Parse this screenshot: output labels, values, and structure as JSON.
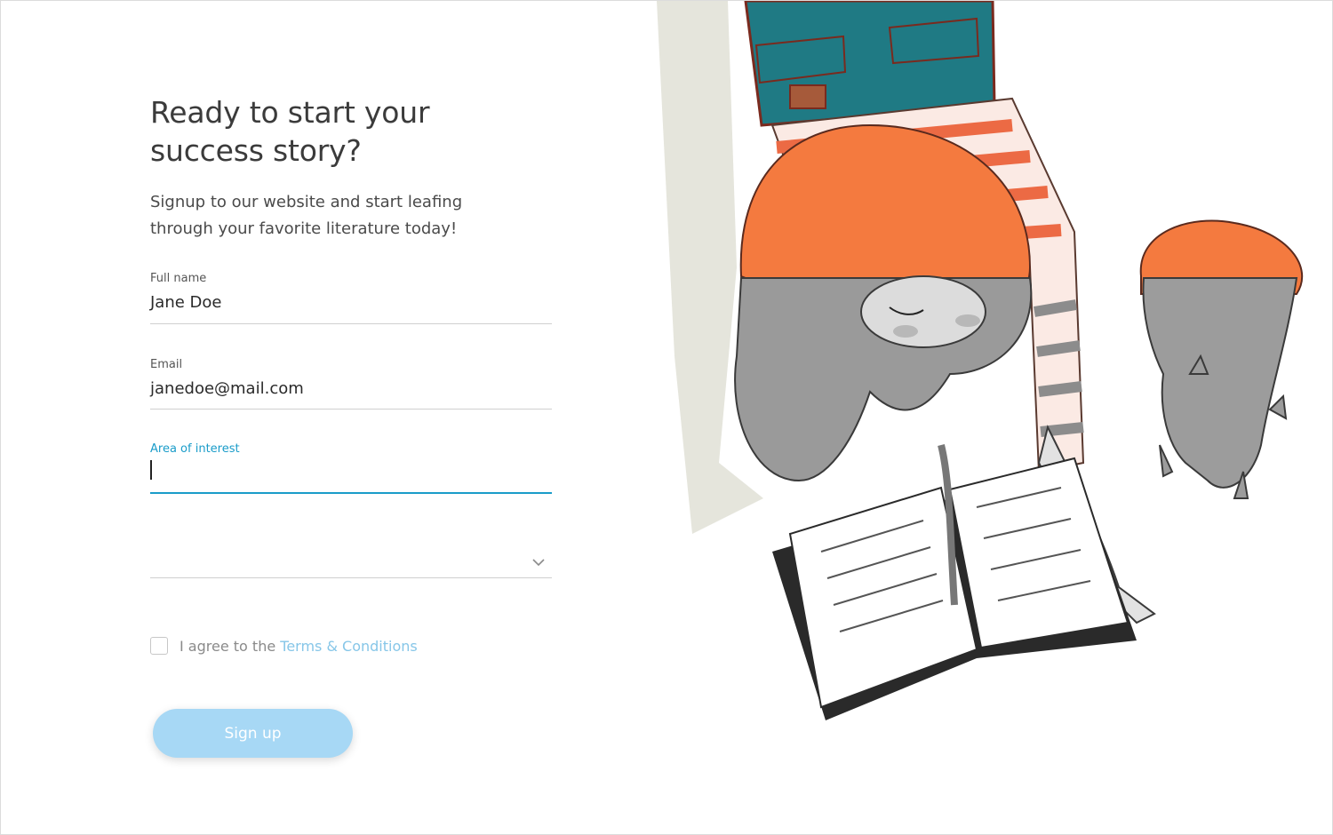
{
  "form": {
    "heading": "Ready to start your success story?",
    "subheading": "Signup to our website and start leafing through your favorite literature today!",
    "fields": {
      "full_name": {
        "label": "Full name",
        "value": "Jane Doe"
      },
      "email": {
        "label": "Email",
        "value": "janedoe@mail.com"
      },
      "area_of_interest": {
        "label": "Area of interest",
        "value": ""
      },
      "select": {
        "value": "",
        "icon": "chevron-down-icon"
      }
    },
    "agree_text": "I agree to the ",
    "terms_link": "Terms & Conditions",
    "signup_button": "Sign up"
  },
  "colors": {
    "accent": "#1a9cc9",
    "button": "#a7d8f5",
    "link": "#86c6e8",
    "hair": "#f47a3f",
    "jeans": "#1f7a84"
  },
  "illustration": {
    "icon": "girl-reading-book-with-cat-illustration"
  }
}
